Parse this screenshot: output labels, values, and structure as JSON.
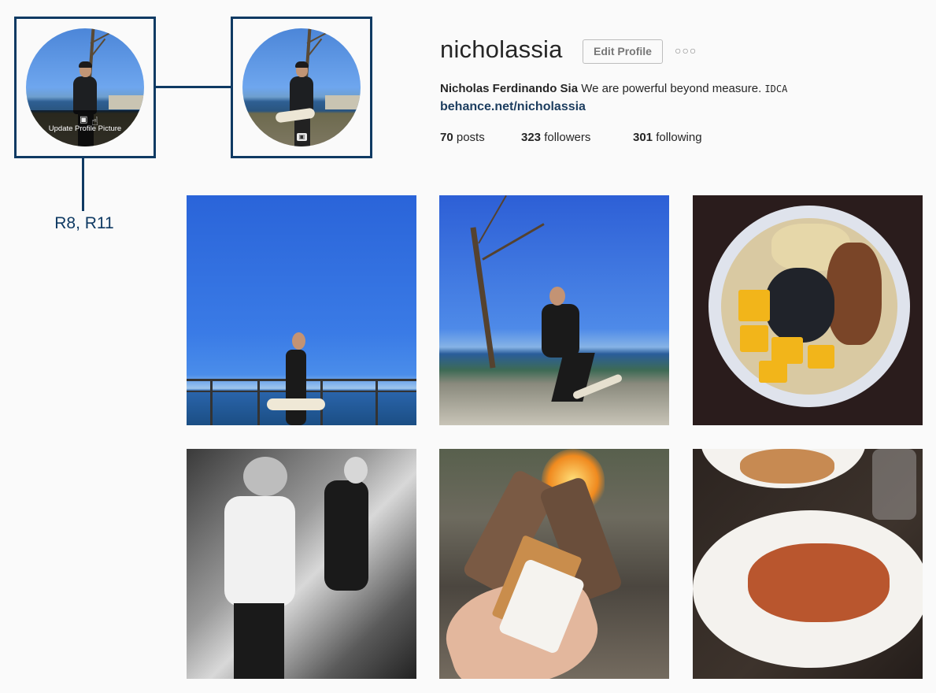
{
  "annotation": {
    "label": "R8, R11"
  },
  "avatar_hover": {
    "overlay_text": "Update Profile Picture"
  },
  "profile": {
    "username": "nicholassia",
    "edit_button_label": "Edit Profile",
    "more_icon": "ellipsis-icon",
    "full_name": "Nicholas Ferdinando Sia",
    "bio": "We are powerful beyond measure.",
    "bio_tag": "IDCA",
    "website": "behance.net/nicholassia",
    "stats": {
      "posts_count": "70",
      "posts_label": "posts",
      "followers_count": "323",
      "followers_label": "followers",
      "following_count": "301",
      "following_label": "following"
    }
  },
  "colors": {
    "annotation": "#0f3a63",
    "link": "#1c3d5f",
    "background": "#fafafa"
  }
}
